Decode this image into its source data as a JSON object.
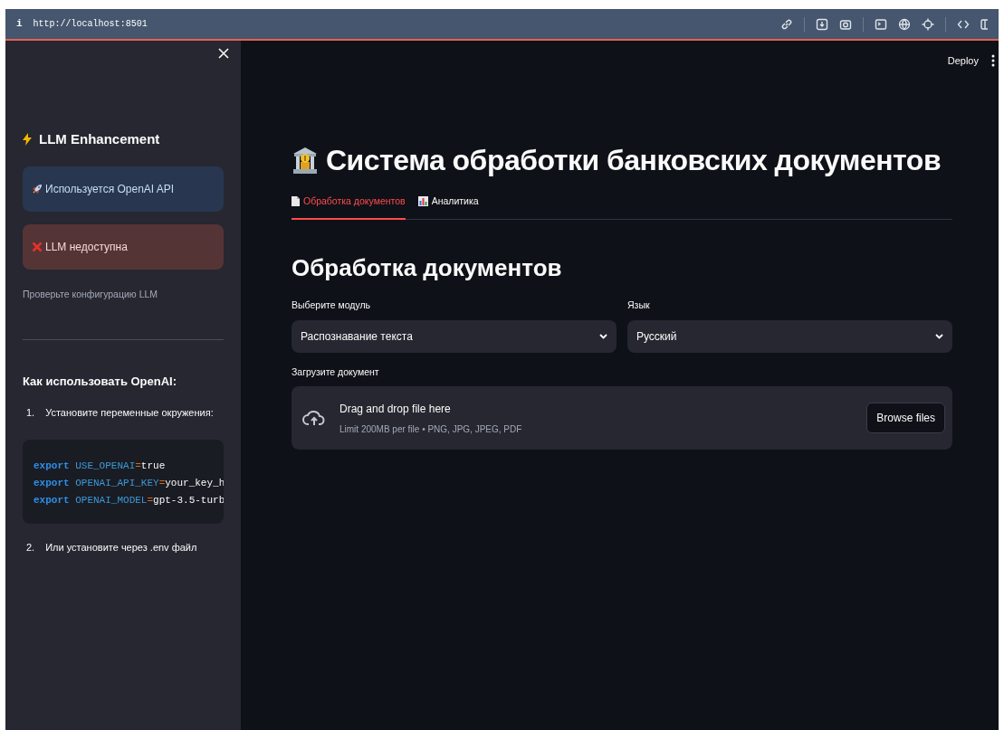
{
  "browser": {
    "url": "http://localhost:8501",
    "info": "i"
  },
  "header": {
    "deploy": "Deploy"
  },
  "sidebar": {
    "section_title": "LLM Enhancement",
    "alerts": [
      {
        "kind": "info",
        "text": "Используется OpenAI API"
      },
      {
        "kind": "error",
        "text": "LLM недоступна"
      }
    ],
    "caption": "Проверьте конфигурацию LLM",
    "howto_title": "Как использовать OpenAI:",
    "steps": [
      {
        "number": "1.",
        "text": "Установите переменные окружения:"
      },
      {
        "number": "2.",
        "text": "Или установите через .env файл"
      }
    ],
    "code_lines": [
      [
        {
          "kind": "keyword",
          "text": "export"
        },
        {
          "kind": "name",
          "text": "USE_OPENAI"
        },
        {
          "kind": "op",
          "text": "="
        },
        {
          "kind": "value",
          "text": "true"
        }
      ],
      [
        {
          "kind": "keyword",
          "text": "export"
        },
        {
          "kind": "name",
          "text": "OPENAI_API_KEY"
        },
        {
          "kind": "op",
          "text": "="
        },
        {
          "kind": "value",
          "text": "your_key_h"
        }
      ],
      [
        {
          "kind": "keyword",
          "text": "export"
        },
        {
          "kind": "name",
          "text": "OPENAI_MODEL"
        },
        {
          "kind": "op",
          "text": "="
        },
        {
          "kind": "value",
          "text": "gpt-3.5-turb"
        }
      ]
    ]
  },
  "main": {
    "title": "Система обработки банковских документов",
    "tabs": [
      {
        "label": "Обработка документов",
        "selected": true
      },
      {
        "label": "Аналитика",
        "selected": false
      }
    ],
    "heading": "Обработка документов",
    "selects": [
      {
        "label": "Выберите модуль",
        "value": "Распознавание текста"
      },
      {
        "label": "Язык",
        "value": "Русский"
      }
    ],
    "uploader": {
      "label": "Загрузите документ",
      "title": "Drag and drop file here",
      "hint": "Limit 200MB per file • PNG, JPG, JPEG, PDF",
      "button": "Browse files"
    }
  }
}
